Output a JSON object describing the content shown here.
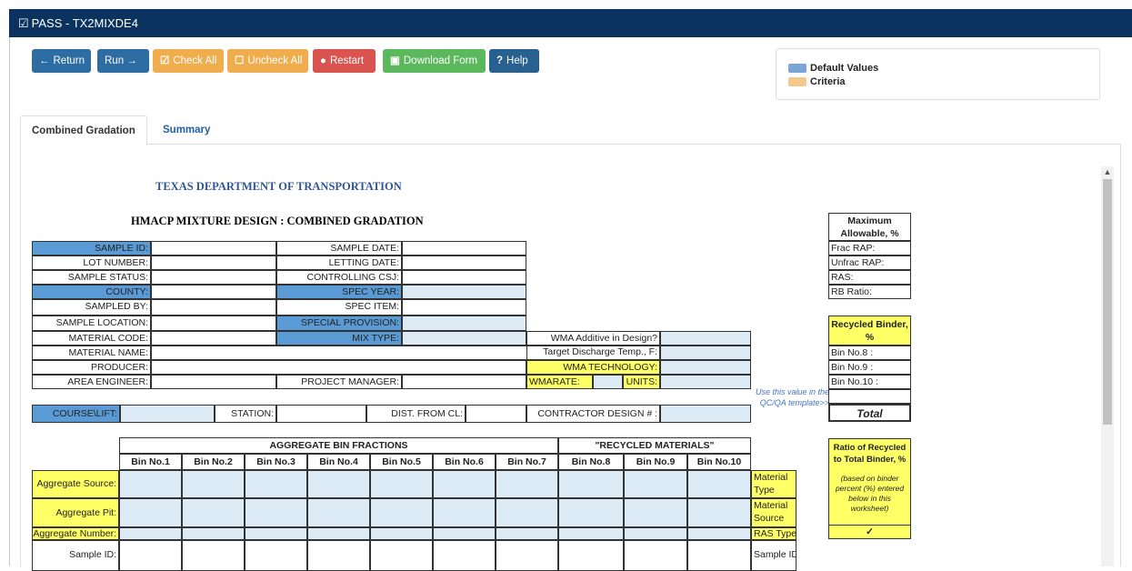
{
  "window": {
    "title": "PASS - TX2MIXDE4",
    "icon": "check-square-icon"
  },
  "toolbar": {
    "return": "Return",
    "run": "Run",
    "check_all": "Check All",
    "uncheck_all": "Uncheck All",
    "restart": "Restart",
    "download": "Download Form",
    "help": "Help",
    "colors": {
      "blue": "#2e6da4",
      "orange": "#f0ad4e",
      "red": "#d9534f",
      "green": "#5cb85c",
      "info": "#286090"
    }
  },
  "legend": {
    "default": "Default Values",
    "criteria": "Criteria",
    "default_color": "#7aa6d6",
    "criteria_color": "#f5c98a"
  },
  "tabs": {
    "combined": "Combined Gradation",
    "summary": "Summary"
  },
  "form": {
    "agency": "TEXAS DEPARTMENT OF TRANSPORTATION",
    "title": "HMACP MIXTURE DESIGN : COMBINED GRADATION",
    "left_labels": [
      "SAMPLE ID:",
      "LOT NUMBER:",
      "SAMPLE STATUS:",
      "COUNTY:",
      "SAMPLED BY:",
      "SAMPLE LOCATION:",
      "MATERIAL CODE:",
      "MATERIAL NAME:",
      "PRODUCER:",
      "AREA ENGINEER:"
    ],
    "mid_labels": [
      "SAMPLE DATE:",
      "LETTING DATE:",
      "CONTROLLING CSJ:",
      "SPEC YEAR:",
      "SPEC ITEM:",
      "SPECIAL PROVISION:",
      "MIX TYPE:"
    ],
    "project_manager": "PROJECT MANAGER:",
    "wma_additive": "WMA Additive in Design?",
    "target_temp": "Target Discharge Temp., F:",
    "wma_tech": "WMA TECHNOLOGY:",
    "wmarate": "WMARATE:",
    "units": "UNITS:",
    "course_lift": "COURSE\\LIFT:",
    "station": "STATION:",
    "dist_cl": "DIST. FROM CL:",
    "contractor": "CONTRACTOR DESIGN # :",
    "note": "Use this value in the QC/QA template>>",
    "max_allow": {
      "title": "Maximum Allowable, %",
      "rows": [
        "Frac RAP:",
        "Unfrac RAP:",
        "RAS:",
        "RB Ratio:"
      ]
    },
    "recycled": {
      "title": "Recycled Binder, %",
      "rows": [
        "Bin No.8 :",
        "Bin No.9 :",
        "Bin No.10 :"
      ],
      "total": "Total"
    },
    "ratio": {
      "title": "Ratio of Recycled to Total Binder, %",
      "note": "(based on binder percent (%) entered below in this worksheet)",
      "check": "✓"
    },
    "agg_header": "AGGREGATE BIN FRACTIONS",
    "rec_header": "\"RECYCLED MATERIALS\"",
    "bins": [
      "Bin No.1",
      "Bin No.2",
      "Bin No.3",
      "Bin No.4",
      "Bin No.5",
      "Bin No.6",
      "Bin No.7",
      "Bin No.8",
      "Bin No.9",
      "Bin No.10"
    ],
    "row_labels": [
      "Aggregate Source:",
      "Aggregate Pit:",
      "Aggregate Number:",
      "Sample ID:"
    ],
    "right_labels": [
      "Material Type",
      "Material Source",
      "RAS Type",
      "Sample ID"
    ]
  }
}
